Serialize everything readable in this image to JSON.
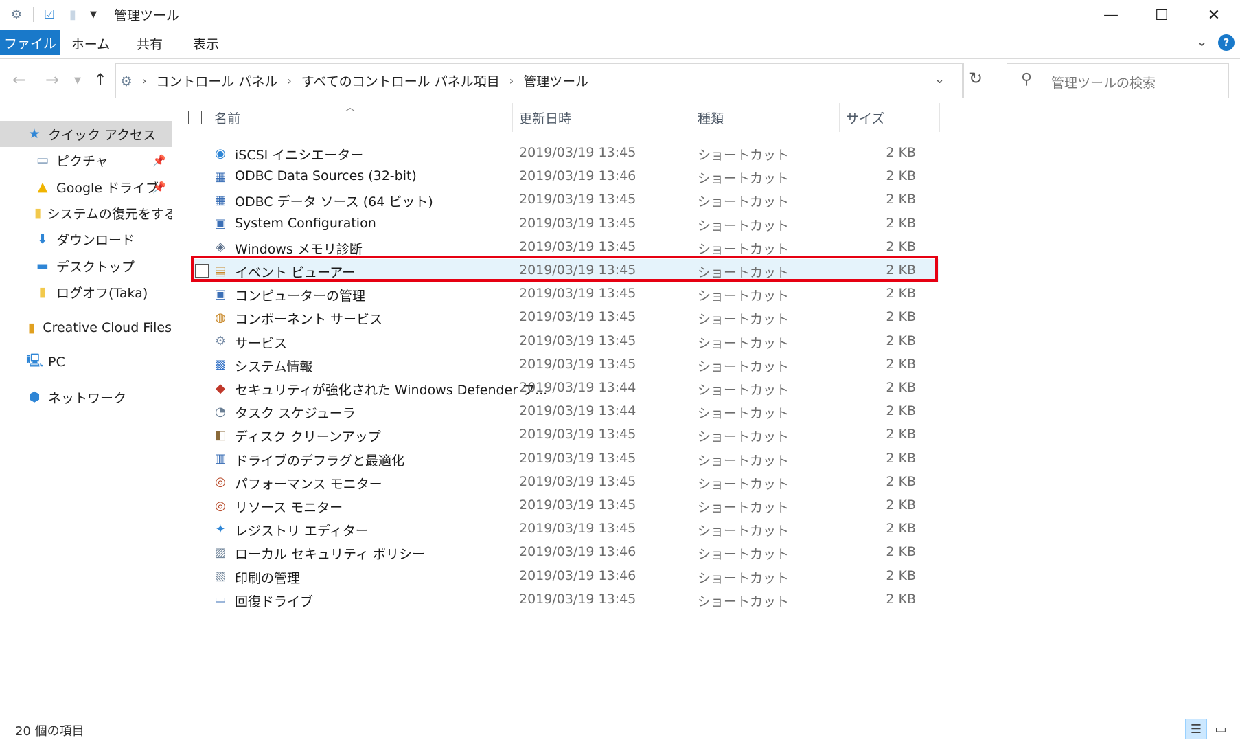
{
  "window": {
    "title": "管理ツール",
    "minimize_glyph": "—",
    "maximize_glyph": "☐",
    "close_glyph": "✕"
  },
  "ribbon": {
    "tabs": [
      "ファイル",
      "ホーム",
      "共有",
      "表示"
    ]
  },
  "address": {
    "crumbs": [
      "コントロール パネル",
      "すべてのコントロール パネル項目",
      "管理ツール"
    ]
  },
  "search": {
    "placeholder": "管理ツールの検索"
  },
  "sidebar": {
    "items": [
      {
        "label": "クイック アクセス",
        "icon": "star-icon"
      },
      {
        "label": "ピクチャ",
        "icon": "pictures-icon"
      },
      {
        "label": "Google ドライブ",
        "icon": "google-drive-icon"
      },
      {
        "label": "システムの復元をする方",
        "icon": "folder-icon"
      },
      {
        "label": "ダウンロード",
        "icon": "download-icon"
      },
      {
        "label": "デスクトップ",
        "icon": "desktop-icon"
      },
      {
        "label": "ログオフ(Taka)",
        "icon": "folder-icon"
      },
      {
        "label": "Creative Cloud Files",
        "icon": "creative-cloud-icon"
      },
      {
        "label": "PC",
        "icon": "pc-icon"
      },
      {
        "label": "ネットワーク",
        "icon": "network-icon"
      }
    ]
  },
  "columns": {
    "name": "名前",
    "date": "更新日時",
    "type": "種類",
    "size": "サイズ"
  },
  "files": [
    {
      "name": "iSCSI イニシエーター",
      "date": "2019/03/19 13:45",
      "type": "ショートカット",
      "size": "2 KB"
    },
    {
      "name": "ODBC Data Sources (32-bit)",
      "date": "2019/03/19 13:46",
      "type": "ショートカット",
      "size": "2 KB"
    },
    {
      "name": "ODBC データ ソース (64 ビット)",
      "date": "2019/03/19 13:45",
      "type": "ショートカット",
      "size": "2 KB"
    },
    {
      "name": "System Configuration",
      "date": "2019/03/19 13:45",
      "type": "ショートカット",
      "size": "2 KB"
    },
    {
      "name": "Windows メモリ診断",
      "date": "2019/03/19 13:45",
      "type": "ショートカット",
      "size": "2 KB"
    },
    {
      "name": "イベント ビューアー",
      "date": "2019/03/19 13:45",
      "type": "ショートカット",
      "size": "2 KB"
    },
    {
      "name": "コンピューターの管理",
      "date": "2019/03/19 13:45",
      "type": "ショートカット",
      "size": "2 KB"
    },
    {
      "name": "コンポーネント サービス",
      "date": "2019/03/19 13:45",
      "type": "ショートカット",
      "size": "2 KB"
    },
    {
      "name": "サービス",
      "date": "2019/03/19 13:45",
      "type": "ショートカット",
      "size": "2 KB"
    },
    {
      "name": "システム情報",
      "date": "2019/03/19 13:45",
      "type": "ショートカット",
      "size": "2 KB"
    },
    {
      "name": "セキュリティが強化された Windows Defender フ...",
      "date": "2019/03/19 13:44",
      "type": "ショートカット",
      "size": "2 KB"
    },
    {
      "name": "タスク スケジューラ",
      "date": "2019/03/19 13:44",
      "type": "ショートカット",
      "size": "2 KB"
    },
    {
      "name": "ディスク クリーンアップ",
      "date": "2019/03/19 13:45",
      "type": "ショートカット",
      "size": "2 KB"
    },
    {
      "name": "ドライブのデフラグと最適化",
      "date": "2019/03/19 13:45",
      "type": "ショートカット",
      "size": "2 KB"
    },
    {
      "name": "パフォーマンス モニター",
      "date": "2019/03/19 13:45",
      "type": "ショートカット",
      "size": "2 KB"
    },
    {
      "name": "リソース モニター",
      "date": "2019/03/19 13:45",
      "type": "ショートカット",
      "size": "2 KB"
    },
    {
      "name": "レジストリ エディター",
      "date": "2019/03/19 13:45",
      "type": "ショートカット",
      "size": "2 KB"
    },
    {
      "name": "ローカル セキュリティ ポリシー",
      "date": "2019/03/19 13:46",
      "type": "ショートカット",
      "size": "2 KB"
    },
    {
      "name": "印刷の管理",
      "date": "2019/03/19 13:46",
      "type": "ショートカット",
      "size": "2 KB"
    },
    {
      "name": "回復ドライブ",
      "date": "2019/03/19 13:45",
      "type": "ショートカット",
      "size": "2 KB"
    }
  ],
  "selected_index": 5,
  "status": {
    "item_count": "20 個の項目"
  },
  "colors": {
    "accent": "#1979ca",
    "selection": "#e5f3fb",
    "highlight_border": "#e60012"
  }
}
